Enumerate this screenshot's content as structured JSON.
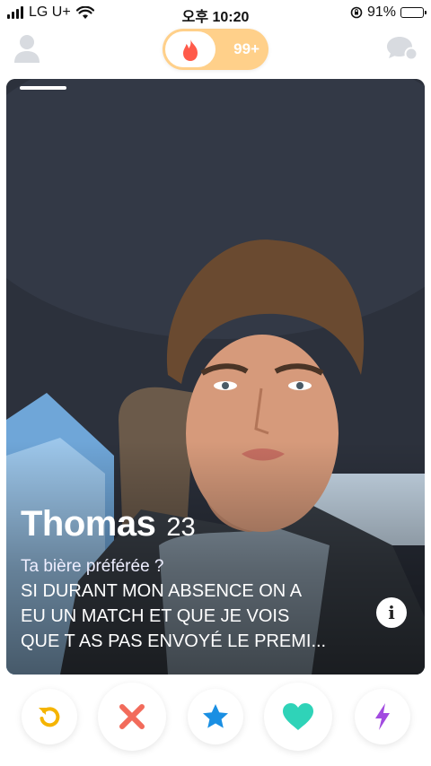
{
  "status_bar": {
    "carrier": "LG U+",
    "time": "오후 10:20",
    "battery_percent": "91%",
    "battery_level": 0.91
  },
  "header": {
    "profile_icon": "profile-icon",
    "toggle_count": "99+",
    "messages_icon": "messages-icon",
    "accent_color": "#ff6b4a",
    "toggle_color": "#ffd08a"
  },
  "card": {
    "name": "Thomas",
    "age": "23",
    "bio_question": "Ta bière préférée ?",
    "bio_answer_line1": "SI DURANT MON ABSENCE ON A",
    "bio_answer_line2": "EU UN MATCH ET QUE JE VOIS",
    "bio_answer_line3": "QUE T AS PAS ENVOYÉ LE PREMI...",
    "info_label": "i"
  },
  "actions": {
    "rewind_icon": "rewind-icon",
    "nope_icon": "close-icon",
    "superlike_icon": "star-icon",
    "like_icon": "heart-icon",
    "boost_icon": "lightning-icon",
    "colors": {
      "rewind": "#f5b400",
      "nope": "#f26b5b",
      "superlike": "#1a8fe3",
      "like": "#2fd3b8",
      "boost": "#a24be0"
    }
  }
}
